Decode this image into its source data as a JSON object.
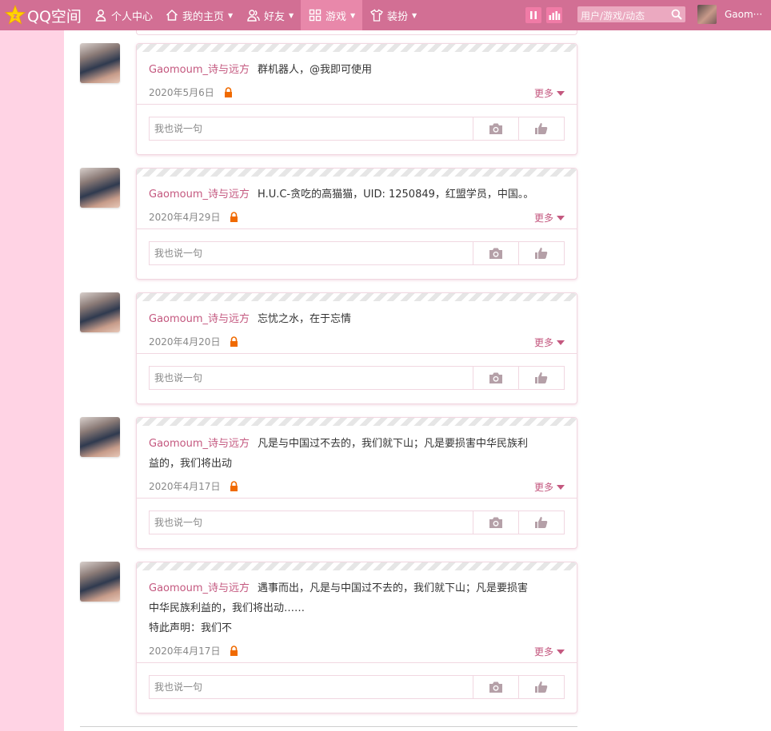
{
  "topbar": {
    "logo_text": "QQ空间",
    "nav": [
      {
        "label": "个人中心",
        "icon": "person-icon"
      },
      {
        "label": "我的主页",
        "icon": "home-icon"
      },
      {
        "label": "好友",
        "icon": "friends-icon"
      },
      {
        "label": "游戏",
        "icon": "apps-grid-icon"
      },
      {
        "label": "装扮",
        "icon": "shirt-icon"
      }
    ],
    "search_placeholder": "用户/游戏/动态",
    "username": "Gaom···"
  },
  "colors": {
    "accent": "#d26f94",
    "left_band": "#ffd3e4",
    "name_color": "#c4587f",
    "lock": "#f06a00"
  },
  "posts": [
    {
      "user": "Gaomoum_诗与远方",
      "text": [
        "群机器人，@我即可使用"
      ],
      "date": "2020年5月6日",
      "more": "更多",
      "comment_placeholder": "我也说一句"
    },
    {
      "user": "Gaomoum_诗与远方",
      "text": [
        "H.U.C-贪吃的高猫猫，UID: 1250849，红盟学员，中国。。"
      ],
      "date": "2020年4月29日",
      "more": "更多",
      "comment_placeholder": "我也说一句"
    },
    {
      "user": "Gaomoum_诗与远方",
      "text": [
        "忘忧之水，在于忘情"
      ],
      "date": "2020年4月20日",
      "more": "更多",
      "comment_placeholder": "我也说一句"
    },
    {
      "user": "Gaomoum_诗与远方",
      "text": [
        "凡是与中国过不去的，我们就下山；凡是要损害中华民族利",
        "益的，我们将出动"
      ],
      "date": "2020年4月17日",
      "more": "更多",
      "comment_placeholder": "我也说一句"
    },
    {
      "user": "Gaomoum_诗与远方",
      "text": [
        "遇事而出，凡是与中国过不去的，我们就下山；凡是要损害",
        "中华民族利益的，我们将出动……",
        "特此声明：我们不"
      ],
      "date": "2020年4月17日",
      "more": "更多",
      "comment_placeholder": "我也说一句"
    }
  ]
}
